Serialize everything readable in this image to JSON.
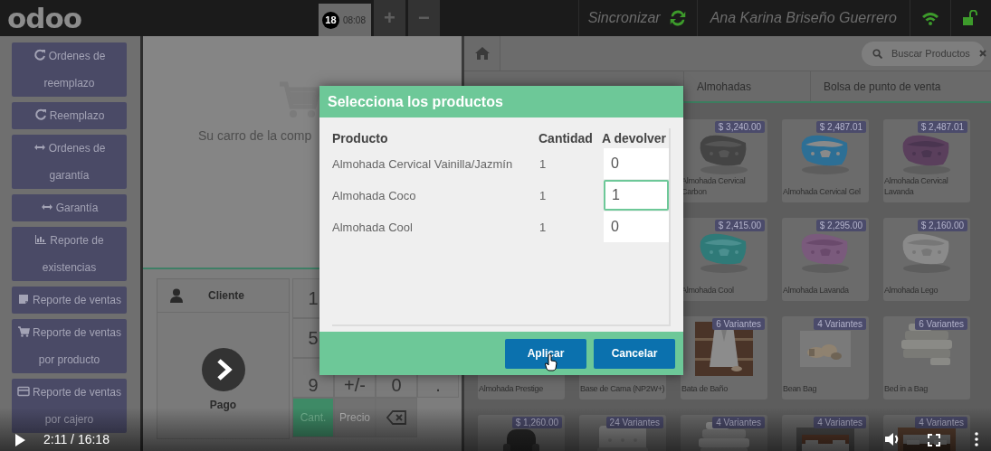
{
  "top_bar": {
    "logo": "odoo",
    "order_tab": {
      "number": "18",
      "time": "08:08",
      "selected": true
    },
    "add_order": "+",
    "remove_order": "−",
    "sync_label": "Sincronizar",
    "user": "Ana Karina Briseño Guerrero"
  },
  "sidebar": {
    "items": [
      {
        "kind": "refresh",
        "label": "Ordenes de reemplazo"
      },
      {
        "kind": "refresh",
        "label": "Reemplazo"
      },
      {
        "kind": "arrows",
        "label": "Ordenes de garantía"
      },
      {
        "kind": "arrows",
        "label": "Garantía"
      },
      {
        "kind": "chart",
        "label": "Reporte de existencias"
      },
      {
        "kind": "note",
        "label": "Reporte de ventas"
      },
      {
        "kind": "cart",
        "label": "Reporte de ventas por producto"
      },
      {
        "kind": "card",
        "label": "Reporte de ventas por cajero"
      }
    ]
  },
  "cart": {
    "empty_message": "Su carro de la comp"
  },
  "control_pad": {
    "customer": "Cliente",
    "payment": "Pago",
    "numpad_rows": [
      [
        "1"
      ],
      [
        "5"
      ],
      [
        "9",
        "+/-",
        "0",
        "."
      ]
    ],
    "modes": [
      {
        "kind": "text",
        "label": "Cant.",
        "selected": true
      },
      {
        "kind": "text",
        "label": "Precio",
        "selected": false
      },
      {
        "kind": "backspace",
        "selected": false
      }
    ]
  },
  "products": {
    "search": {
      "placeholder": "Buscar Productos"
    },
    "categories": [
      {
        "label": "Almohadas"
      },
      {
        "label": "Bolsa de punto de venta"
      }
    ],
    "rows": [
      {
        "cards": [
          {
            "badge": "$ 3,240.00",
            "name": "Almohada Cervical Carbon"
          },
          {
            "badge": "$ 2,487.01",
            "name": "Almohada Cervical Gel"
          },
          {
            "badge": "$ 2,487.01",
            "name": "Almohada Cervical Lavanda"
          }
        ]
      },
      {
        "cards": [
          {
            "badge": "$ 2,415.00",
            "name": "Almohada Cool"
          },
          {
            "badge": "$ 2,295.00",
            "name": "Almohada Lavanda"
          },
          {
            "badge": "$ 2,160.00",
            "name": "Almohada Lego"
          }
        ]
      },
      {
        "cards": [
          {
            "name": "Almohada Prestige"
          },
          {
            "name": "Base de Cama (NP2W+)"
          },
          {
            "badge": "6 Variantes",
            "name": "Bata de Baño"
          },
          {
            "badge": "4 Variantes",
            "name": "Bean Bag"
          },
          {
            "badge": "6 Variantes",
            "name": "Bed in a Bag"
          }
        ]
      },
      {
        "cards": [
          {
            "badge": "$ 1,260.00"
          },
          {
            "badge": "24 Variantes"
          },
          {
            "badge": "4 Variantes"
          },
          {
            "badge": "4 Variantes"
          },
          {
            "badge": "4 Variantes"
          }
        ]
      }
    ]
  },
  "dialog": {
    "title": "Selecciona los productos",
    "columns": [
      "Producto",
      "Cantidad",
      "A devolver"
    ],
    "rows": [
      {
        "product": "Almohada Cervical Vainilla/Jazmín",
        "quantity": "1",
        "return_quantity": "0",
        "focused": false
      },
      {
        "product": "Almohada Coco",
        "quantity": "1",
        "return_quantity": "1",
        "focused": true
      },
      {
        "product": "Almohada Cool",
        "quantity": "1",
        "return_quantity": "0",
        "focused": false
      }
    ],
    "buttons": [
      {
        "label": "Aplicar"
      },
      {
        "label": "Cancelar"
      }
    ]
  },
  "video_player": {
    "time": "2:11 / 16:18"
  }
}
